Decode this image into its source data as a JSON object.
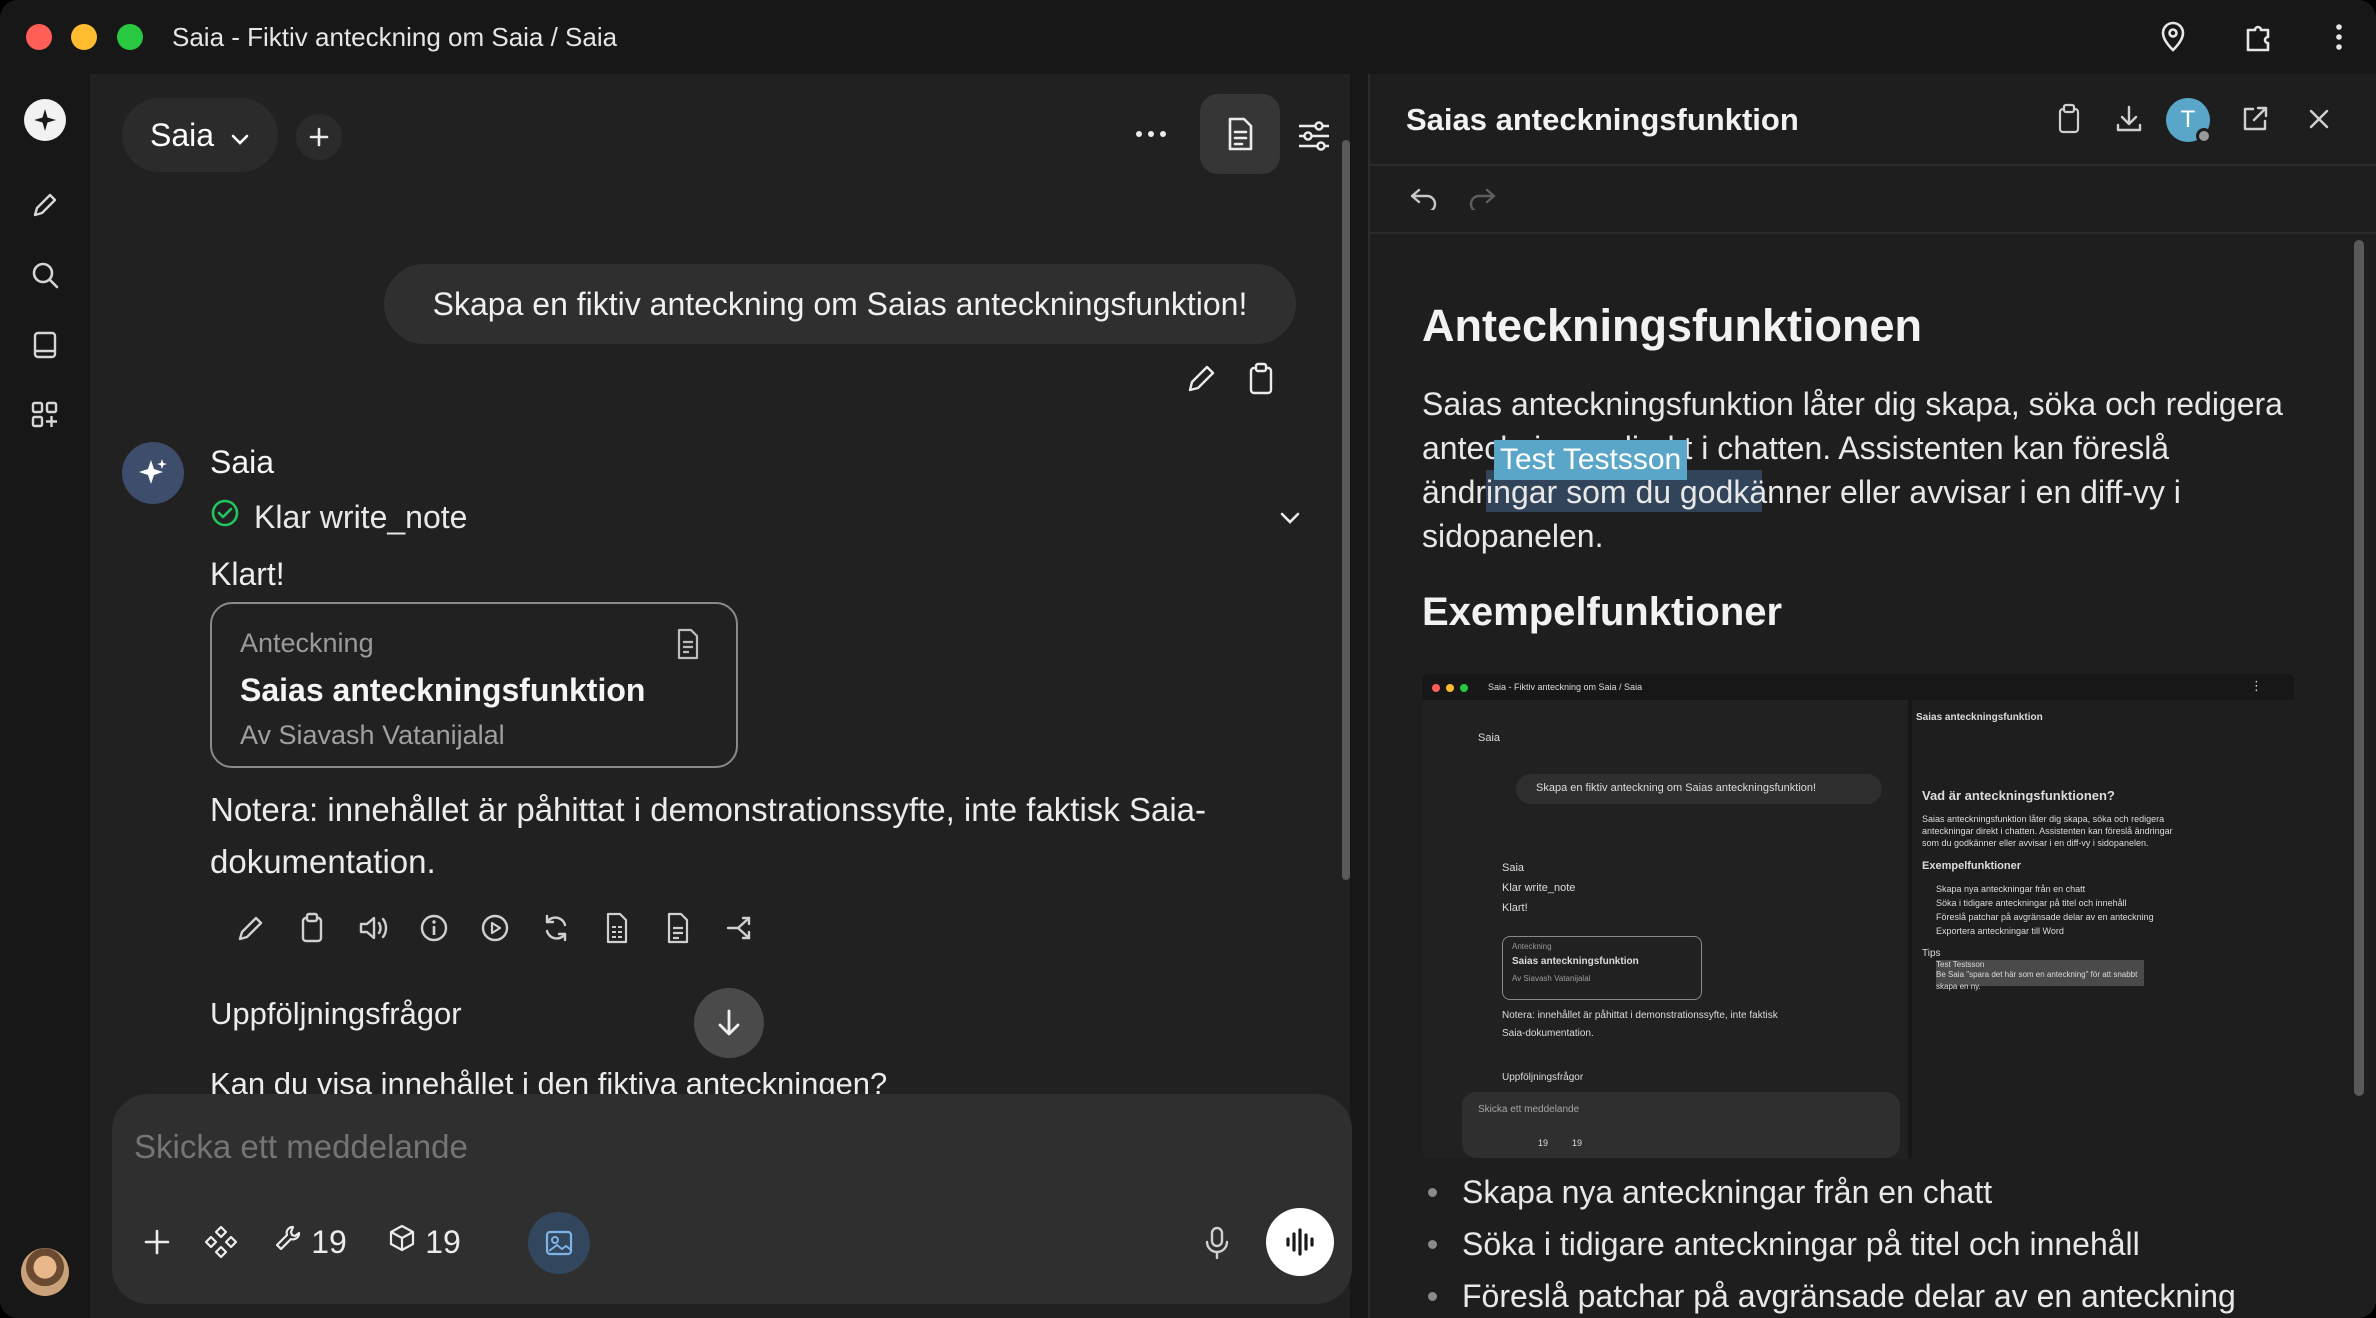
{
  "window": {
    "title": "Saia - Fiktiv anteckning om Saia / Saia"
  },
  "header": {
    "model": "Saia"
  },
  "chat": {
    "user_message": "Skapa en fiktiv anteckning om Saias anteckningsfunktion!",
    "assistant_name": "Saia",
    "tool_status": "Klar write_note",
    "reply_short": "Klart!",
    "note_card": {
      "label": "Anteckning",
      "title": "Saias anteckningsfunktion",
      "author": "Av Siavash Vatanijalal"
    },
    "disclaimer": "Notera: innehållet är påhittat i demonstrationssyfte, inte faktisk Saia-dokumentation.",
    "followup_heading": "Uppföljningsfrågor",
    "followup_question": "Kan du visa innehållet i den fiktiva anteckningen?"
  },
  "composer": {
    "placeholder": "Skicka ett meddelande",
    "tools_count": "19",
    "knowledge_count": "19"
  },
  "panel": {
    "title": "Saias anteckningsfunktion",
    "avatar_initial": "T",
    "collaborator_tag": "Test Testsson",
    "doc_heading": "Anteckningsfunktionen",
    "doc_paragraph": "Saias anteckningsfunktion låter dig skapa, söka och redigera anteckningar direkt i chatten. Assistenten kan föreslå ändringar som du godkänner eller avvisar i en diff-vy i sidopanelen.",
    "doc_subheading": "Exempelfunktioner",
    "bullets": [
      "Skapa nya anteckningar från en chatt",
      "Söka i tidigare anteckningar på titel och innehåll",
      "Föreslå patchar på avgränsade delar av en anteckning"
    ]
  },
  "embedded_screenshot": {
    "window_title": "Saia - Fiktiv anteckning om Saia / Saia",
    "model": "Saia",
    "user_message": "Skapa en fiktiv anteckning om Saias anteckningsfunktion!",
    "assistant_name": "Saia",
    "tool_status": "Klar write_note",
    "reply_short": "Klart!",
    "card_label": "Anteckning",
    "card_title": "Saias anteckningsfunktion",
    "card_author": "Av Siavash Vatanijalal",
    "disclaimer_1": "Notera: innehållet är påhittat i demonstrationssyfte, inte faktisk",
    "disclaimer_2": "Saia-dokumentation.",
    "followup": "Uppföljningsfrågor",
    "placeholder": "Skicka ett meddelande",
    "tools_count": "19",
    "knowledge_count": "19",
    "panel_title": "Saias anteckningsfunktion",
    "doc_heading": "Vad är anteckningsfunktionen?",
    "doc_p1": "Saias anteckningsfunktion låter dig skapa, söka och redigera",
    "doc_p2": "anteckningar direkt i chatten. Assistenten kan föreslå ändringar",
    "doc_p3": "som du godkänner eller avvisar i en diff-vy i sidopanelen.",
    "doc_subheading": "Exempelfunktioner",
    "bullets": [
      "Skapa nya anteckningar från en chatt",
      "Söka i tidigare anteckningar på titel och innehåll",
      "Föreslå patchar på avgränsade delar av en anteckning",
      "Exportera anteckningar till Word"
    ],
    "tips_heading": "Tips",
    "tips_tag": "Test Testsson",
    "tips_1": "Be Saia \"spara det här som en anteckning\" för att snabbt",
    "tips_2": "skapa en ny."
  },
  "colors": {
    "accent_blue": "#5aa6c8",
    "success_green": "#22c55e",
    "background": "#212121"
  }
}
